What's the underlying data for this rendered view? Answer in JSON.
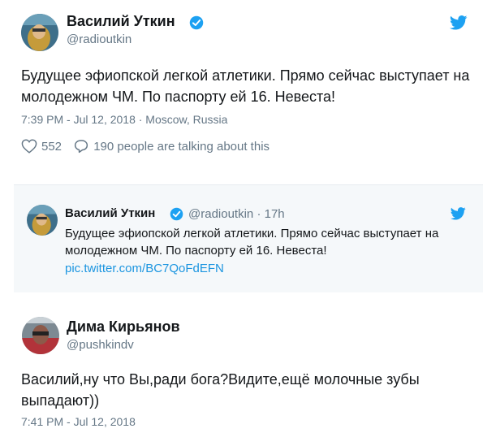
{
  "tweet1": {
    "author_name": "Василий Уткин",
    "handle": "@radioutkin",
    "text": "Будущее эфиопской легкой атлетики. Прямо сейчас выступает на молодежном ЧМ. По паспорту ей 16. Невеста!",
    "timestamp": "7:39 PM - Jul 12, 2018 · Moscow, Russia",
    "likes": "552",
    "replies_text": "190 people are talking about this",
    "icons": {
      "verified": "verified-badge-icon",
      "brand": "twitter-bird-icon",
      "like": "heart-icon",
      "reply": "speech-bubble-icon"
    }
  },
  "quote": {
    "author_name": "Василий Уткин",
    "handle": "@radioutkin",
    "time": "17h",
    "text": "Будущее эфиопской легкой атлетики. Прямо сейчас выступает на молодежном ЧМ. По паспорту ей 16. Невеста!",
    "link": "pic.twitter.com/BC7QoFdEFN"
  },
  "tweet2": {
    "author_name": "Дима Кирьянов",
    "handle": "@pushkindv",
    "text": "Василий,ну что Вы,ради бога?Видите,ещё молочные зубы выпадают))",
    "timestamp": "7:41 PM - Jul 12, 2018"
  },
  "colors": {
    "verified": "#1da1f2",
    "brand": "#1da1f2",
    "link": "#1b95e0",
    "muted": "#657786",
    "quote_bg": "#f5f8fa"
  }
}
